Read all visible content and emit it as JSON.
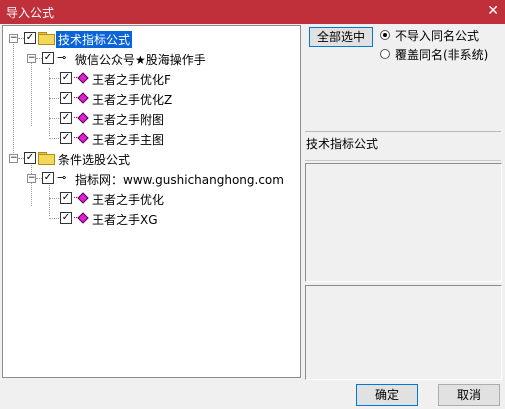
{
  "window": {
    "title": "导入公式",
    "close_glyph": "✕"
  },
  "tree": {
    "root1": {
      "label": "技术指标公式",
      "group": {
        "label": "微信公众号★股海操作手",
        "items": [
          "王者之手优化F",
          "王者之手优化Z",
          "王者之手附图",
          "王者之手主图"
        ]
      }
    },
    "root2": {
      "label": "条件选股公式",
      "group": {
        "label": "指标网：www.gushichanghong.com",
        "items": [
          "王者之手优化",
          "王者之手XG"
        ]
      }
    }
  },
  "side": {
    "select_all_label": "全部选中",
    "radio_options": [
      "不导入同名公式",
      "覆盖同名(非系统)"
    ],
    "selected_radio": 0,
    "section_label": "技术指标公式"
  },
  "buttons": {
    "ok": "确定",
    "cancel": "取消"
  },
  "glyphs": {
    "check": "✓",
    "expand": "−",
    "key": "⊸"
  },
  "colors": {
    "titlebar": "#c0303a",
    "selection": "#0a64d8",
    "diamond": "#e020d0"
  }
}
